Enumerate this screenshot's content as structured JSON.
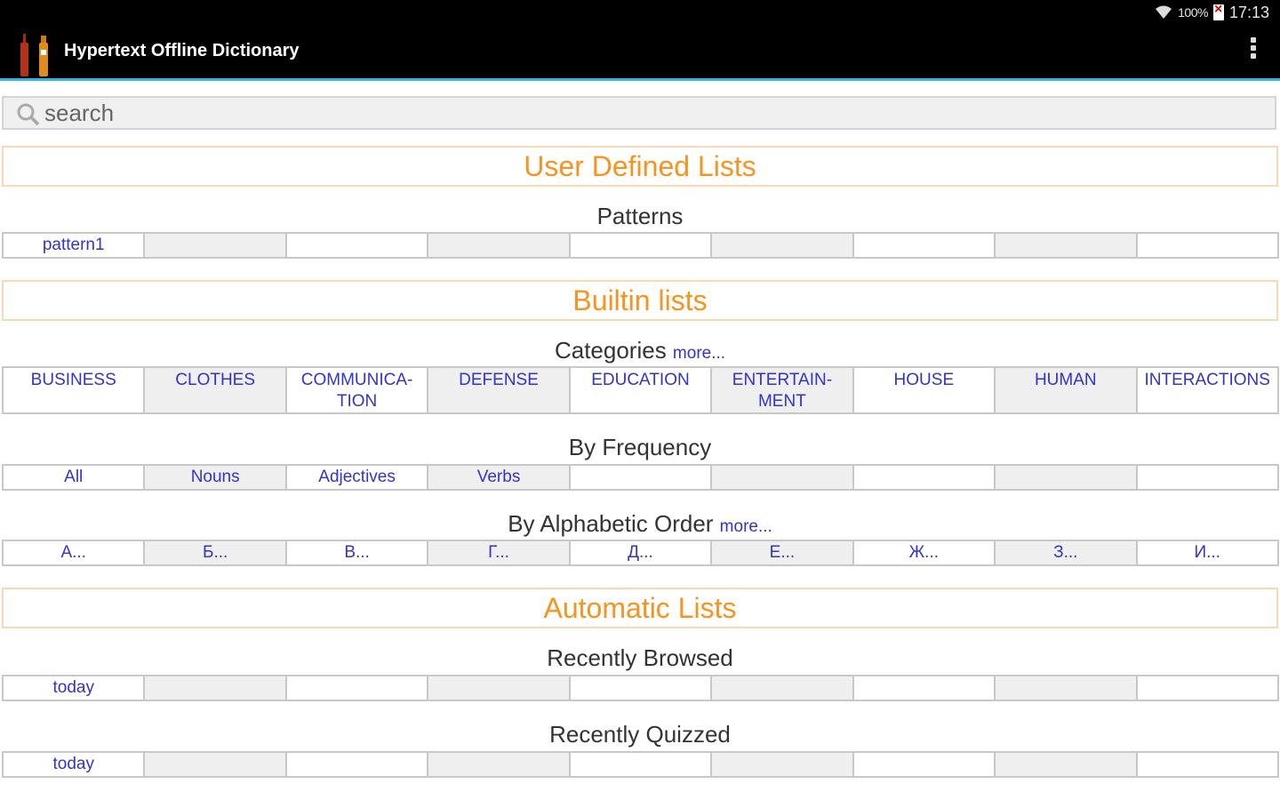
{
  "status": {
    "battery_pct": "100%",
    "time": "17:13"
  },
  "app": {
    "title": "Hypertext Offline Dictionary"
  },
  "search": {
    "placeholder": "search"
  },
  "user_defined": {
    "header": "User Defined Lists",
    "patterns_title": "Patterns",
    "patterns": [
      "pattern1",
      "",
      "",
      "",
      "",
      "",
      "",
      "",
      ""
    ]
  },
  "builtin": {
    "header": "Builtin lists",
    "categories_title": "Categories",
    "categories_more": "more...",
    "categories": [
      "BUSINESS",
      "CLOTHES",
      "COMMUNICA-\nTION",
      "DEFENSE",
      "EDUCATION",
      "ENTERTAIN-\nMENT",
      "HOUSE",
      "HUMAN",
      "INTERACTIONS"
    ],
    "frequency_title": "By Frequency",
    "frequency": [
      "All",
      "Nouns",
      "Adjectives",
      "Verbs",
      "",
      "",
      "",
      "",
      ""
    ],
    "alphabetic_title": "By Alphabetic Order",
    "alphabetic_more": "more...",
    "alphabetic": [
      "А...",
      "Б...",
      "В...",
      "Г...",
      "Д...",
      "Е...",
      "Ж...",
      "З...",
      "И..."
    ]
  },
  "automatic": {
    "header": "Automatic Lists",
    "browsed_title": "Recently Browsed",
    "browsed": [
      "today",
      "",
      "",
      "",
      "",
      "",
      "",
      "",
      ""
    ],
    "quizzed_title": "Recently Quizzed",
    "quizzed": [
      "today",
      "",
      "",
      "",
      "",
      "",
      "",
      "",
      ""
    ]
  },
  "colors": {
    "accent": "#f7931e",
    "link": "#3333cc",
    "actionbar": "#000000",
    "divider": "#33b5e5"
  }
}
